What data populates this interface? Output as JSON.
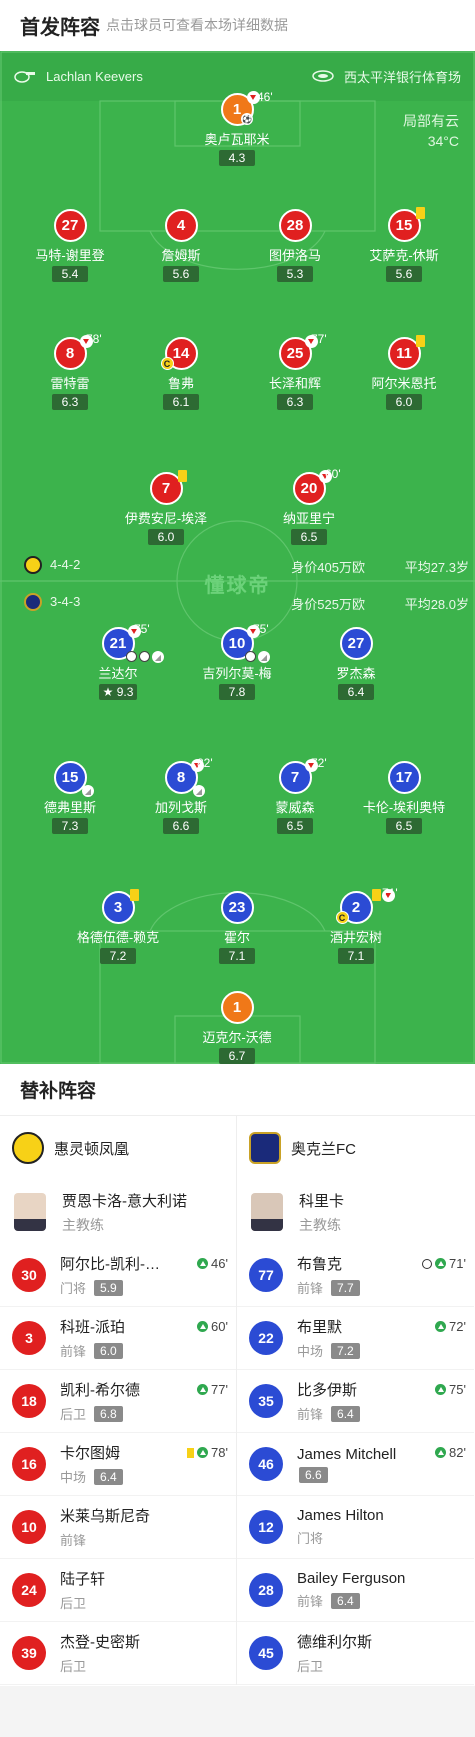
{
  "header": {
    "title": "首发阵容",
    "subtitle": "点击球员可查看本场详细数据"
  },
  "pitch": {
    "home_coach_label": "Lachlan Keevers",
    "stadium": "西太平洋银行体育场",
    "weather": "局部有云",
    "temperature": "34°C",
    "watermark": "懂球帝"
  },
  "home_team_line": {
    "formation": "4-4-2",
    "value": "身价405万欧",
    "avg_age": "平均27.3岁"
  },
  "away_team_line": {
    "formation": "3-4-3",
    "value": "身价525万欧",
    "avg_age": "平均28.0岁"
  },
  "home_players": [
    {
      "num": "1",
      "name": "奥卢瓦耶米",
      "rating": "4.3",
      "sub": "46'"
    },
    {
      "num": "27",
      "name": "马特-谢里登",
      "rating": "5.4"
    },
    {
      "num": "4",
      "name": "詹姆斯",
      "rating": "5.6"
    },
    {
      "num": "28",
      "name": "图伊洛马",
      "rating": "5.3"
    },
    {
      "num": "15",
      "name": "艾萨克-休斯",
      "rating": "5.6"
    },
    {
      "num": "8",
      "name": "雷特雷",
      "rating": "6.3",
      "sub": "78'"
    },
    {
      "num": "14",
      "name": "鲁弗",
      "rating": "6.1"
    },
    {
      "num": "25",
      "name": "长泽和辉",
      "rating": "6.3",
      "sub": "77'"
    },
    {
      "num": "11",
      "name": "阿尔米恩托",
      "rating": "6.0"
    },
    {
      "num": "7",
      "name": "伊费安尼-埃泽",
      "rating": "6.0"
    },
    {
      "num": "20",
      "name": "纳亚里宁",
      "rating": "6.5",
      "sub": "60'"
    }
  ],
  "away_players": [
    {
      "num": "21",
      "name": "兰达尔",
      "rating": "9.3",
      "sub": "75'"
    },
    {
      "num": "10",
      "name": "吉列尔莫-梅",
      "rating": "7.8",
      "sub": "75'"
    },
    {
      "num": "27",
      "name": "罗杰森",
      "rating": "6.4"
    },
    {
      "num": "15",
      "name": "德弗里斯",
      "rating": "7.3"
    },
    {
      "num": "8",
      "name": "加列戈斯",
      "rating": "6.6",
      "sub": "82'"
    },
    {
      "num": "7",
      "name": "蒙威森",
      "rating": "6.5",
      "sub": "72'"
    },
    {
      "num": "17",
      "name": "卡伦-埃利奥特",
      "rating": "6.5"
    },
    {
      "num": "3",
      "name": "格德伍德-赖克",
      "rating": "7.2"
    },
    {
      "num": "23",
      "name": "霍尔",
      "rating": "7.1"
    },
    {
      "num": "2",
      "name": "酒井宏树",
      "rating": "7.1",
      "sub": "71'"
    },
    {
      "num": "1",
      "name": "迈克尔-沃德",
      "rating": "6.7"
    }
  ],
  "subs": {
    "title": "替补阵容",
    "home": {
      "team": "惠灵顿凤凰",
      "coach_name": "贾恩卡洛-意大利诺",
      "coach_role": "主教练",
      "players": [
        {
          "num": "30",
          "name": "阿尔比-凯利-…",
          "pos": "门将",
          "rating": "5.9",
          "time": "46'"
        },
        {
          "num": "3",
          "name": "科班-派珀",
          "pos": "前锋",
          "rating": "6.0",
          "time": "60'"
        },
        {
          "num": "18",
          "name": "凯利-希尔德",
          "pos": "后卫",
          "rating": "6.8",
          "time": "77'"
        },
        {
          "num": "16",
          "name": "卡尔图姆",
          "pos": "中场",
          "rating": "6.4",
          "time": "78'"
        },
        {
          "num": "10",
          "name": "米莱乌斯尼奇",
          "pos": "前锋"
        },
        {
          "num": "24",
          "name": "陆子轩",
          "pos": "后卫"
        },
        {
          "num": "39",
          "name": "杰登-史密斯",
          "pos": "后卫"
        }
      ]
    },
    "away": {
      "team": "奥克兰FC",
      "coach_name": "科里卡",
      "coach_role": "主教练",
      "players": [
        {
          "num": "77",
          "name": "布鲁克",
          "pos": "前锋",
          "rating": "7.7",
          "time": "71'"
        },
        {
          "num": "22",
          "name": "布里默",
          "pos": "中场",
          "rating": "7.2",
          "time": "72'"
        },
        {
          "num": "35",
          "name": "比多伊斯",
          "pos": "前锋",
          "rating": "6.4",
          "time": "75'"
        },
        {
          "num": "46",
          "name": "James Mitchell",
          "pos": "",
          "rating": "6.6",
          "time": "82'"
        },
        {
          "num": "12",
          "name": "James Hilton",
          "pos": "门将"
        },
        {
          "num": "28",
          "name": "Bailey Ferguson",
          "pos": "前锋",
          "rating": "6.4"
        },
        {
          "num": "45",
          "name": "德维利尔斯",
          "pos": "后卫"
        }
      ]
    }
  },
  "colors": {
    "pitch": "#3cb34c",
    "home": "#e02020",
    "away": "#2b4bd4",
    "keeper": "#f07818"
  }
}
